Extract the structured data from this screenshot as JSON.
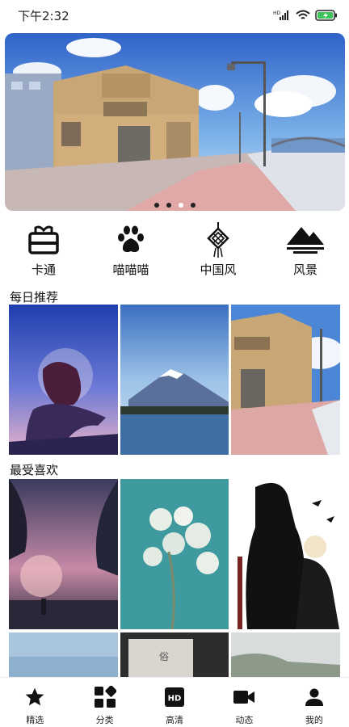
{
  "status_bar": {
    "time": "下午2:32",
    "network": "HD"
  },
  "banner": {
    "page_count": 4,
    "active_page": 3
  },
  "categories": [
    {
      "label": "卡通",
      "icon": "cartoon-icon"
    },
    {
      "label": "喵喵喵",
      "icon": "paw-icon"
    },
    {
      "label": "中国风",
      "icon": "chinese-knot-icon"
    },
    {
      "label": "风景",
      "icon": "mountain-icon"
    }
  ],
  "sections": {
    "daily": {
      "title": "每日推荐"
    },
    "favorite": {
      "title": "最受喜欢"
    }
  },
  "bottom_nav": [
    {
      "label": "精选",
      "icon": "star-icon"
    },
    {
      "label": "分类",
      "icon": "category-icon"
    },
    {
      "label": "高清",
      "icon": "hd-icon"
    },
    {
      "label": "动态",
      "icon": "video-icon"
    },
    {
      "label": "我的",
      "icon": "person-icon"
    }
  ],
  "colors": {
    "accent": "#111111",
    "background": "#ffffff",
    "battery": "#3cc35a"
  }
}
